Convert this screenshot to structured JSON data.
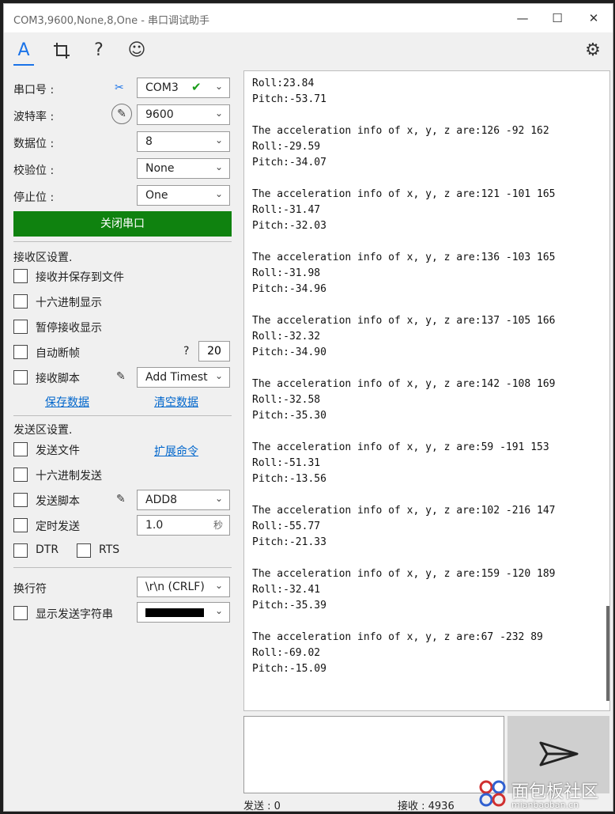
{
  "window": {
    "title": "COM3,9600,None,8,One - 串口调试助手"
  },
  "toolbar": {
    "icons": [
      "font-icon",
      "crop-icon",
      "help-icon",
      "smiley-icon"
    ],
    "settings_icon": "gear-icon"
  },
  "left": {
    "port": {
      "label": "串口号 :",
      "value": "COM3"
    },
    "baud": {
      "label": "波特率 :",
      "value": "9600"
    },
    "databits": {
      "label": "数据位 :",
      "value": "8"
    },
    "parity": {
      "label": "校验位 :",
      "value": "None"
    },
    "stopbits": {
      "label": "停止位 :",
      "value": "One"
    },
    "close_button": "关闭串口",
    "recv_section": "接收区设置.",
    "recv_options": [
      "接收并保存到文件",
      "十六进制显示",
      "暂停接收显示",
      "自动断帧",
      "接收脚本"
    ],
    "auto_frame_value": "20",
    "help_mark": "?",
    "recv_script_value": "Add Timest",
    "save_data": "保存数据",
    "clear_data": "清空数据",
    "send_section": "发送区设置.",
    "send_options": [
      "发送文件",
      "十六进制发送",
      "发送脚本",
      "定时发送"
    ],
    "ext_cmd": "扩展命令",
    "send_script_value": "ADD8",
    "timer_value": "1.0",
    "timer_unit": "秒",
    "dtr": "DTR",
    "rts": "RTS",
    "newline_label": "换行符",
    "newline_value": "\\r\\n (CRLF)",
    "show_send_label": "显示发送字符串"
  },
  "receive": {
    "text": "Roll:23.84\nPitch:-53.71\n\nThe acceleration info of x, y, z are:126 -92 162\nRoll:-29.59\nPitch:-34.07\n\nThe acceleration info of x, y, z are:121 -101 165\nRoll:-31.47\nPitch:-32.03\n\nThe acceleration info of x, y, z are:136 -103 165\nRoll:-31.98\nPitch:-34.96\n\nThe acceleration info of x, y, z are:137 -105 166\nRoll:-32.32\nPitch:-34.90\n\nThe acceleration info of x, y, z are:142 -108 169\nRoll:-32.58\nPitch:-35.30\n\nThe acceleration info of x, y, z are:59 -191 153\nRoll:-51.31\nPitch:-13.56\n\nThe acceleration info of x, y, z are:102 -216 147\nRoll:-55.77\nPitch:-21.33\n\nThe acceleration info of x, y, z are:159 -120 189\nRoll:-32.41\nPitch:-35.39\n\nThe acceleration info of x, y, z are:67 -232 89\nRoll:-69.02\nPitch:-15.09"
  },
  "status": {
    "sent": "发送 : 0",
    "received": "接收 : 4936"
  },
  "watermark": {
    "text": "面包板社区",
    "sub": "mianbaoban.cn"
  },
  "colors": {
    "accent": "#1a73e8",
    "close_button": "#0f820f",
    "check": "#1a9c1a"
  }
}
